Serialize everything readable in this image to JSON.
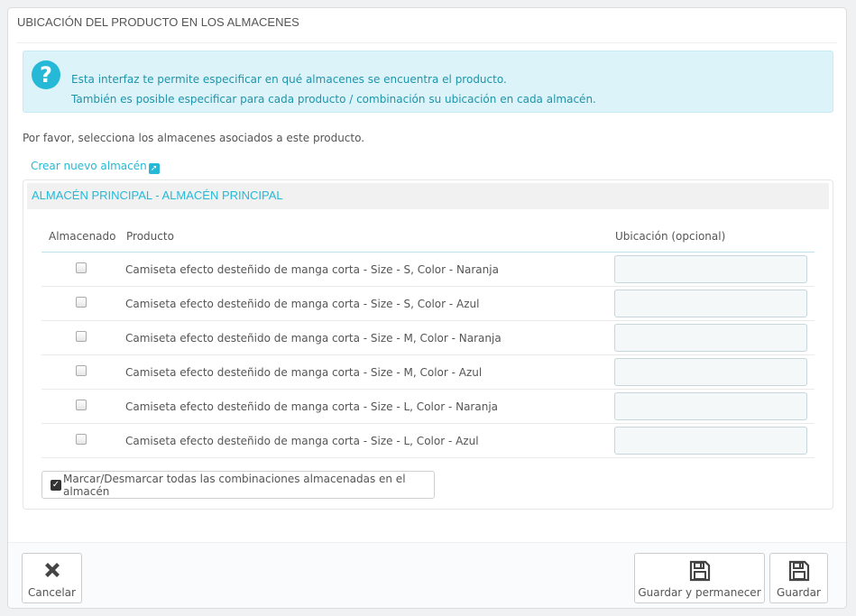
{
  "panel": {
    "title": "UBICACIÓN DEL PRODUCTO EN LOS ALMACENES"
  },
  "alert": {
    "icon": "question-circle-icon",
    "line1": "Esta interfaz te permite especificar en qué almacenes se encuentra el producto.",
    "line2": "También es posible especificar para cada producto / combinación su ubicación en cada almacén."
  },
  "intro": "Por favor, selecciona los almacenes asociados a este producto.",
  "create_link": {
    "label": "Crear nuevo almacén",
    "icon": "external-link-icon"
  },
  "warehouse": {
    "title": "ALMACÉN PRINCIPAL - ALMACÉN PRINCIPAL",
    "columns": {
      "stored": "Almacenado",
      "product": "Producto",
      "location": "Ubicación (opcional)"
    },
    "rows": [
      {
        "product": "Camiseta efecto desteñido de manga corta - Size - S, Color - Naranja",
        "checked": false,
        "location": ""
      },
      {
        "product": "Camiseta efecto desteñido de manga corta - Size - S, Color - Azul",
        "checked": false,
        "location": ""
      },
      {
        "product": "Camiseta efecto desteñido de manga corta - Size - M, Color - Naranja",
        "checked": false,
        "location": ""
      },
      {
        "product": "Camiseta efecto desteñido de manga corta - Size - M, Color - Azul",
        "checked": false,
        "location": ""
      },
      {
        "product": "Camiseta efecto desteñido de manga corta - Size - L, Color - Naranja",
        "checked": false,
        "location": ""
      },
      {
        "product": "Camiseta efecto desteñido de manga corta - Size - L, Color - Azul",
        "checked": false,
        "location": ""
      }
    ],
    "toggle_all_label": "Marcar/Desmarcar todas las combinaciones almacenadas en el almacén"
  },
  "footer": {
    "cancel_label": "Cancelar",
    "save_stay_label": "Guardar y permanecer",
    "save_label": "Guardar"
  },
  "colors": {
    "accent": "#25b9d7",
    "alert_bg": "#dcf4f9",
    "alert_text": "#1e94ab"
  }
}
